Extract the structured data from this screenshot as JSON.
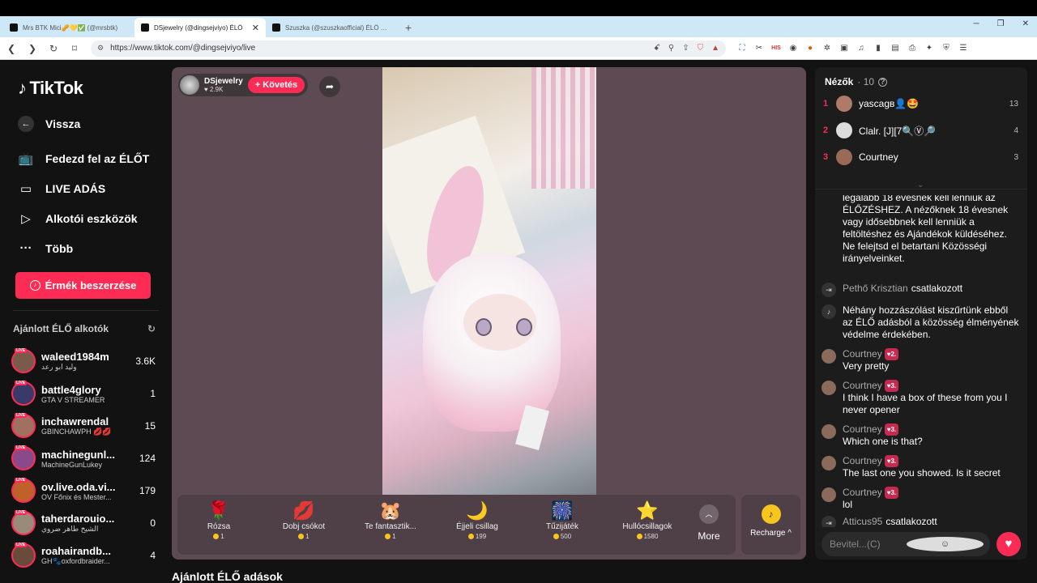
{
  "browser": {
    "tabs": [
      {
        "label": "Mrs BTK Mici🥜💛✅ (@mrsbtk)",
        "active": false
      },
      {
        "label": "DSjewelry (@dingsejviyo) ÉLŐ",
        "active": true
      },
      {
        "label": "Szuszka (@szuszkaofficial) ÉLŐ adás",
        "active": false
      }
    ],
    "url": "https://www.tiktok.com/@dingsejviyo/live"
  },
  "sidebar": {
    "logo": "TikTok",
    "back": "Vissza",
    "nav": [
      "Fedezd fel az ÉLŐT",
      "LIVE ADÁS",
      "Alkotói eszközök",
      "Több"
    ],
    "buy_coins": "Érmék beszerzése",
    "recommended_title": "Ajánlott ÉLŐ alkotók",
    "creators": [
      {
        "name": "waleed1984m",
        "sub": "وليد ابو رعد",
        "count": "3.6K",
        "color": "#7a5a4a"
      },
      {
        "name": "battle4glory",
        "sub": "GTA V STREAMER",
        "count": "1",
        "color": "#3a3a6a"
      },
      {
        "name": "inchawrendal",
        "sub": "GBINCHAWPH 💋💋",
        "count": "15",
        "color": "#a07060"
      },
      {
        "name": "machinegunl...",
        "sub": "MachineGunLukey",
        "count": "124",
        "color": "#8a4a8a"
      },
      {
        "name": "ov.live.oda.vi...",
        "sub": "OV Főnix és Mester...",
        "count": "179",
        "color": "#c0602a"
      },
      {
        "name": "taherdarouio...",
        "sub": "الشيخ طاهر ضروي",
        "count": "0",
        "color": "#9a8a7a"
      },
      {
        "name": "roahairandb...",
        "sub": "GH🐾oxfordbraider...",
        "count": "4",
        "color": "#6a4a3a"
      }
    ]
  },
  "stream": {
    "streamer": "DSjewelry",
    "likes": "2.9K",
    "follow": "Követés",
    "gifts": [
      {
        "icon": "🌹",
        "name": "Rózsa",
        "price": "1"
      },
      {
        "icon": "💋",
        "name": "Dobj csókot",
        "price": "1"
      },
      {
        "icon": "🐹",
        "name": "Te fantasztik...",
        "price": "1"
      },
      {
        "icon": "🌙",
        "name": "Éjjeli csillag",
        "price": "199"
      },
      {
        "icon": "🎆",
        "name": "Tűzijáték",
        "price": "500"
      },
      {
        "icon": "⭐",
        "name": "Hullócsillagok",
        "price": "1580"
      }
    ],
    "more": "More",
    "recharge": "Recharge",
    "recommended_live": "Ajánlott ÉLŐ adások"
  },
  "viewers": {
    "title": "Nézők",
    "count": "10",
    "top": [
      {
        "rank": "1",
        "name": "yascagв👤🤩",
        "score": "13"
      },
      {
        "rank": "2",
        "name": "Clalr. [J][7🔍Ⓥ🔎",
        "score": "4"
      },
      {
        "rank": "3",
        "name": "Courtney",
        "score": "3"
      }
    ]
  },
  "chat": {
    "system1": "legalább 18 évesnek kell lenniük az ÉLŐZÉSHEZ. A nézőknek 18 évesnek vagy idősebbnek kell lenniük a feltöltéshez és Ajándékok küldéséhez. Ne felejtsd el betartani Közösségi irányelveinket.",
    "join1_user": "Pethő Krisztian",
    "joined": "csatlakozott",
    "system2": "Néhány hozzászólást kiszűrtünk ebből az ÉLŐ adásból a közösség élményének védelme érdekében.",
    "messages": [
      {
        "user": "Courtney",
        "badge": "2.",
        "text": "Very pretty"
      },
      {
        "user": "Courtney",
        "badge": "3.",
        "text": "I think I have a box of these from you I never opener"
      },
      {
        "user": "Courtney",
        "badge": "3.",
        "text": "Which one is that?"
      },
      {
        "user": "Courtney",
        "badge": "3.",
        "text": "The last one you showed. Is it secret"
      },
      {
        "user": "Courtney",
        "badge": "3.",
        "text": "lol"
      }
    ],
    "join2_user": "Atticus95",
    "input_placeholder": "Bevitel...(C)"
  }
}
